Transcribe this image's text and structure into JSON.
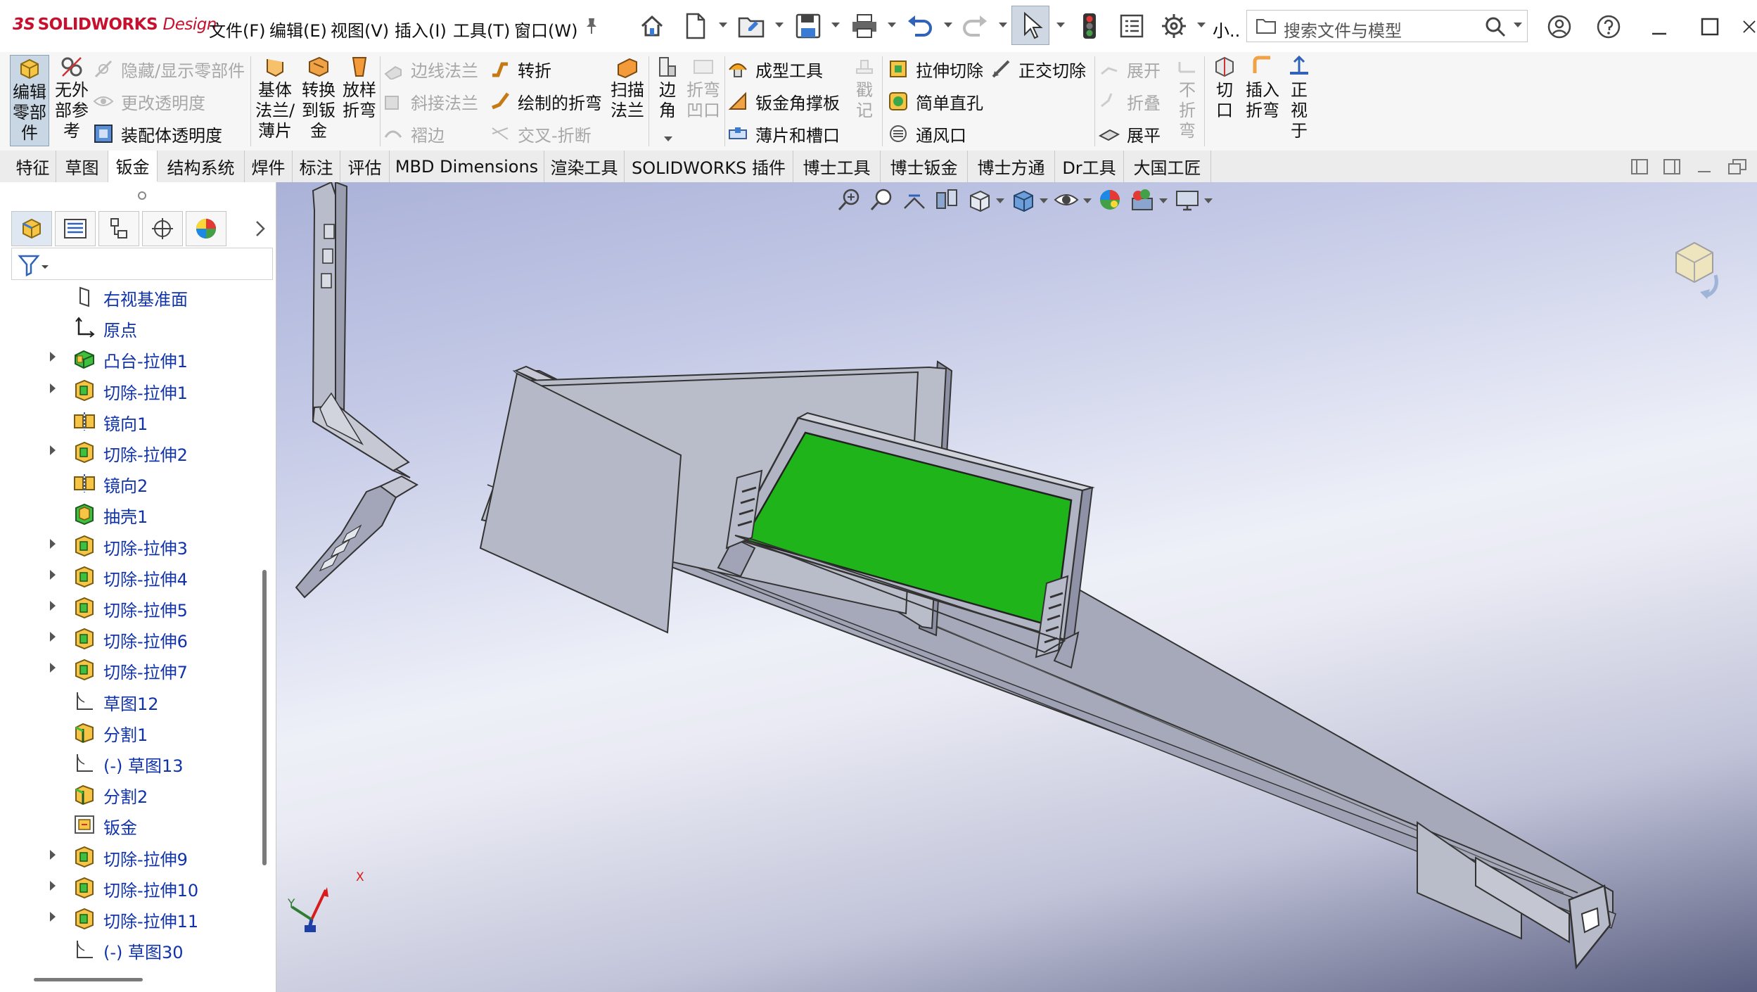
{
  "app": {
    "logo_ds": "3S",
    "logo_solid": "SOLIDWORKS",
    "logo_design": "Design"
  },
  "menu": [
    "文件(F)",
    "编辑(E)",
    "视图(V)",
    "插入(I)",
    "工具(T)",
    "窗口(W)"
  ],
  "quick_access": {
    "user_short": "小..",
    "search_placeholder": "搜索文件与模型"
  },
  "commands": {
    "edit_part": [
      "编辑",
      "零部",
      "件"
    ],
    "no_external_ref": [
      "无外",
      "部参",
      "考"
    ],
    "hide_show_parts": "隐藏/显示零部件",
    "change_transparency": "更改透明度",
    "assembly_transparency": "装配体透明度",
    "base_flange": [
      "基体",
      "法兰/",
      "薄片"
    ],
    "convert_sheet_metal": [
      "转换",
      "到钣",
      "金"
    ],
    "lofted_bend": [
      "放样",
      "折弯"
    ],
    "edge_flange": "边线法兰",
    "miter_flange": "斜接法兰",
    "hem": "褶边",
    "jog": "转折",
    "sketched_bend": "绘制的折弯",
    "cross_break": "交叉-折断",
    "swept_flange": [
      "扫描",
      "法兰"
    ],
    "corners": [
      "边",
      "角"
    ],
    "fold_notch": [
      "折弯",
      "凹口"
    ],
    "forming_tool": "成型工具",
    "gusset": "钣金角撑板",
    "tab_slot": "薄片和槽口",
    "stamp": [
      "戳",
      "记"
    ],
    "extruded_cut": "拉伸切除",
    "simple_hole": "简单直孔",
    "vent": "通风口",
    "normal_cut": "正交切除",
    "unfold": "展开",
    "fold": "折叠",
    "flatten": "展平",
    "no_bends": [
      "不",
      "折",
      "弯"
    ],
    "rip": [
      "切",
      "口"
    ],
    "insert_bends": [
      "插入",
      "折弯"
    ],
    "normal_to": [
      "正",
      "视",
      "于"
    ]
  },
  "tabs": [
    {
      "label": "特征",
      "active": false
    },
    {
      "label": "草图",
      "active": false
    },
    {
      "label": "钣金",
      "active": true
    },
    {
      "label": "结构系统",
      "active": false
    },
    {
      "label": "焊件",
      "active": false
    },
    {
      "label": "标注",
      "active": false
    },
    {
      "label": "评估",
      "active": false
    },
    {
      "label": "MBD Dimensions",
      "active": false
    },
    {
      "label": "渲染工具",
      "active": false
    },
    {
      "label": "SOLIDWORKS 插件",
      "active": false
    },
    {
      "label": "博士工具",
      "active": false
    },
    {
      "label": "博士钣金",
      "active": false
    },
    {
      "label": "博士方通",
      "active": false
    },
    {
      "label": "Dr工具",
      "active": false
    },
    {
      "label": "大国工匠",
      "active": false
    }
  ],
  "feature_tree": [
    {
      "label": "右视基准面",
      "icon": "plane-icon",
      "expandable": false
    },
    {
      "label": "原点",
      "icon": "origin-icon",
      "expandable": false
    },
    {
      "label": "凸台-拉伸1",
      "icon": "boss-extrude-icon",
      "expandable": true
    },
    {
      "label": "切除-拉伸1",
      "icon": "cut-extrude-icon",
      "expandable": true
    },
    {
      "label": "镜向1",
      "icon": "mirror-icon",
      "expandable": false
    },
    {
      "label": "切除-拉伸2",
      "icon": "cut-extrude-icon",
      "expandable": true
    },
    {
      "label": "镜向2",
      "icon": "mirror-icon",
      "expandable": false
    },
    {
      "label": "抽壳1",
      "icon": "shell-icon",
      "expandable": false
    },
    {
      "label": "切除-拉伸3",
      "icon": "cut-extrude-icon",
      "expandable": true
    },
    {
      "label": "切除-拉伸4",
      "icon": "cut-extrude-icon",
      "expandable": true
    },
    {
      "label": "切除-拉伸5",
      "icon": "cut-extrude-icon",
      "expandable": true
    },
    {
      "label": "切除-拉伸6",
      "icon": "cut-extrude-icon",
      "expandable": true
    },
    {
      "label": "切除-拉伸7",
      "icon": "cut-extrude-icon",
      "expandable": true
    },
    {
      "label": "草图12",
      "icon": "sketch-icon",
      "expandable": false
    },
    {
      "label": "分割1",
      "icon": "split-icon",
      "expandable": false
    },
    {
      "label": "(-) 草图13",
      "icon": "sketch-icon",
      "expandable": false
    },
    {
      "label": "分割2",
      "icon": "split-icon",
      "expandable": false
    },
    {
      "label": "钣金",
      "icon": "sheet-metal-icon",
      "expandable": false
    },
    {
      "label": "切除-拉伸9",
      "icon": "cut-extrude-icon",
      "expandable": true
    },
    {
      "label": "切除-拉伸10",
      "icon": "cut-extrude-icon",
      "expandable": true
    },
    {
      "label": "切除-拉伸11",
      "icon": "cut-extrude-icon",
      "expandable": true
    },
    {
      "label": "(-) 草图30",
      "icon": "sketch-icon",
      "expandable": false
    }
  ],
  "triad": {
    "x_label": "X",
    "y_label": "Y"
  },
  "colors": {
    "accent_select": "#cfd8e2",
    "tree_text": "#1133aa",
    "face_green": "#1fb51a",
    "model_gray": "#a9acbb"
  }
}
